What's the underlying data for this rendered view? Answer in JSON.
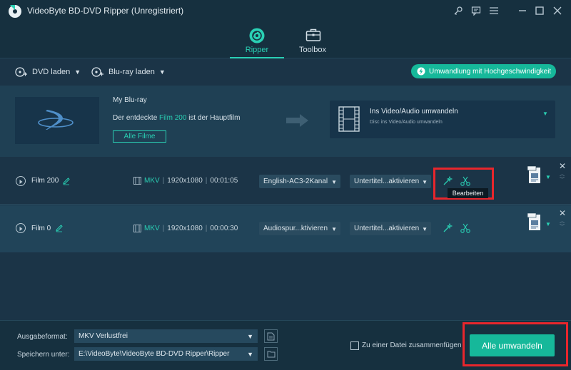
{
  "window": {
    "title": "VideoByte BD-DVD Ripper (Unregistriert)"
  },
  "nav": {
    "tabs": [
      {
        "label": "Ripper"
      },
      {
        "label": "Toolbox"
      }
    ]
  },
  "toolbar": {
    "dvd_load_label": "DVD laden",
    "bluray_load_label": "Blu-ray laden",
    "hispeed_label": "Umwandlung mit Hochgeschwindigkeit"
  },
  "disc": {
    "name": "My Blu-ray",
    "main_film_prefix": "Der entdeckte",
    "main_film_name": "Film 200",
    "main_film_suffix": "ist der Hauptfilm",
    "all_films_label": "Alle Filme"
  },
  "convert_target": {
    "title": "Ins Video/Audio umwandeln",
    "subtitle": "Disc ins Video/Audio umwandeln"
  },
  "films": [
    {
      "name": "Film 200",
      "format": "MKV",
      "resolution": "1920x1080",
      "duration": "00:01:05",
      "audio": "English-AC3-2Kanal",
      "subtitle": "Untertitel...aktivieren"
    },
    {
      "name": "Film 0",
      "format": "MKV",
      "resolution": "1920x1080",
      "duration": "00:00:30",
      "audio": "Audiospur...ktivieren",
      "subtitle": "Untertitel...aktivieren"
    }
  ],
  "tooltip": {
    "edit": "Bearbeiten"
  },
  "bottom": {
    "output_format_label": "Ausgabeformat:",
    "output_format_value": "MKV Verlustfrei",
    "save_to_label": "Speichern unter:",
    "save_to_value": "E:\\VideoByte\\VideoByte BD-DVD Ripper\\Ripper",
    "merge_label": "Zu einer Datei zusammenfügen",
    "convert_all_label": "Alle umwandeln"
  },
  "colors": {
    "accent": "#2ad0b4",
    "button": "#16b89a",
    "highlight": "#e8262c"
  }
}
